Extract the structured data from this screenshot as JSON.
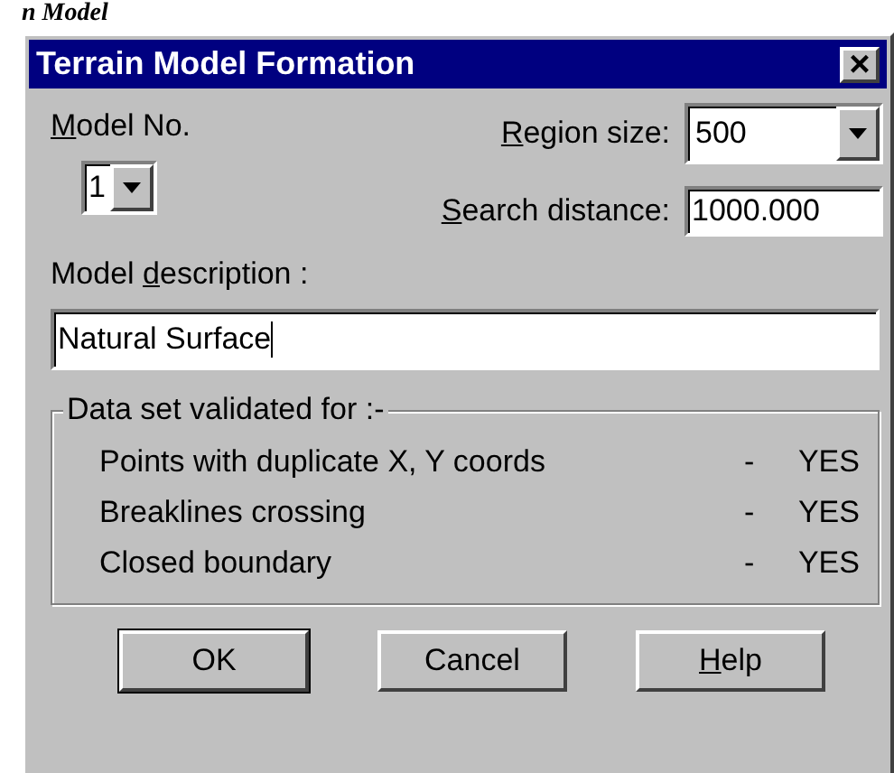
{
  "caption": "n Model",
  "window": {
    "title": "Terrain Model Formation",
    "close": "×"
  },
  "model_no": {
    "label": {
      "key": "M",
      "after": "odel No."
    },
    "value": "1"
  },
  "region_size": {
    "label": {
      "key": "R",
      "after": "egion size:"
    },
    "value": "500"
  },
  "search_distance": {
    "label": {
      "key": "S",
      "after": "earch distance:"
    },
    "value": "1000.000"
  },
  "model_description": {
    "label": {
      "before": "Model ",
      "key": "d",
      "after": "escription :"
    },
    "value": "Natural Surface",
    "focused": true
  },
  "validation": {
    "title": "Data set validated for :-",
    "rows": [
      {
        "label": "Points with duplicate X, Y coords",
        "dash": "-",
        "result": "YES"
      },
      {
        "label": "Breaklines crossing",
        "dash": "-",
        "result": "YES"
      },
      {
        "label": "Closed boundary",
        "dash": "-",
        "result": "YES"
      }
    ]
  },
  "buttons": [
    {
      "label": {
        "after": "OK"
      },
      "default": true
    },
    {
      "label": {
        "after": "Cancel"
      },
      "default": false
    },
    {
      "label": {
        "key": "H",
        "after": "elp"
      },
      "default": false
    }
  ]
}
